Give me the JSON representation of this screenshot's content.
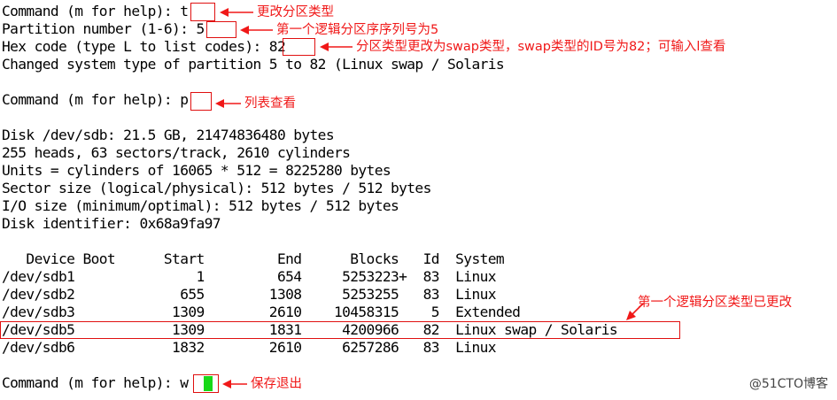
{
  "terminal": {
    "lines": [
      "Command (m for help): t",
      "Partition number (1-6): 5",
      "Hex code (type L to list codes): 82",
      "Changed system type of partition 5 to 82 (Linux swap / Solaris",
      "",
      "Command (m for help): p",
      "",
      "Disk /dev/sdb: 21.5 GB, 21474836480 bytes",
      "255 heads, 63 sectors/track, 2610 cylinders",
      "Units = cylinders of 16065 * 512 = 8225280 bytes",
      "Sector size (logical/physical): 512 bytes / 512 bytes",
      "I/O size (minimum/optimal): 512 bytes / 512 bytes",
      "Disk identifier: 0x68a9fa97",
      "",
      "   Device Boot      Start         End      Blocks   Id  System",
      "/dev/sdb1               1         654     5253223+  83  Linux",
      "/dev/sdb2             655        1308     5253255   83  Linux",
      "/dev/sdb3            1309        2610    10458315    5  Extended",
      "/dev/sdb5            1309        1831     4200966   82  Linux swap / Solaris",
      "/dev/sdb6            1832        2610     6257286   83  Linux",
      "",
      "Command (m for help): w"
    ]
  },
  "annotations": {
    "change_type": "更改分区类型",
    "first_logical": "第一个逻辑分区序序列号为5",
    "swap_note": "分区类型更改为swap类型，swap类型的ID号为82；可输入l查看",
    "list_view": "列表查看",
    "changed_note": "第一个逻辑分区类型已更改",
    "save_exit": "保存退出"
  },
  "watermark": "@51CTO博客",
  "colors": {
    "annotation": "#f01818",
    "cursor": "#18d818",
    "background": "#ffffff",
    "text": "#000000"
  }
}
